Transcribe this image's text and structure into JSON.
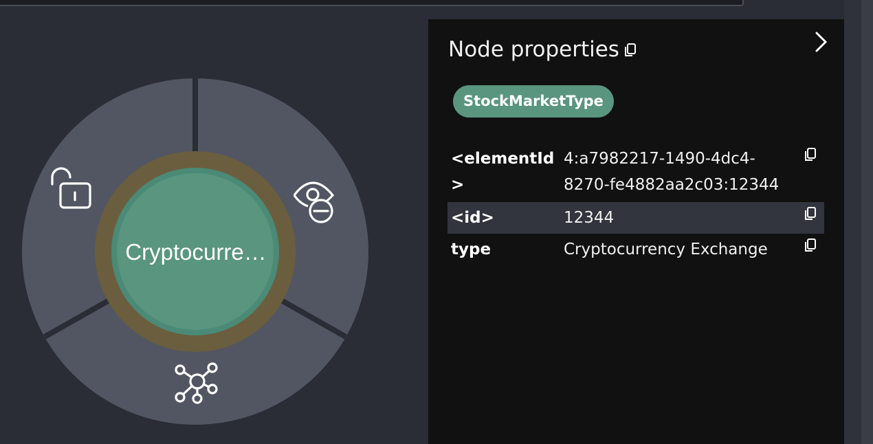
{
  "canvas": {
    "node_label": "Cryptocurre…",
    "ring_colors": {
      "outer": "#525662",
      "node_border": "#6b5e3e",
      "node_fill": "#5a9580"
    },
    "menu": {
      "lock": {
        "icon": "unlock-icon"
      },
      "hide": {
        "icon": "eye-hide-icon"
      },
      "expand": {
        "icon": "graph-expand-icon"
      }
    }
  },
  "panel": {
    "title": "Node properties",
    "title_copy_icon": "copy-icon",
    "collapse_icon": "chevron-right-icon",
    "labels": [
      "StockMarketType"
    ],
    "properties": [
      {
        "key_line1": "<elementId",
        "key_line2": ">",
        "value_line1": "4:a7982217-1490-4dc4-",
        "value_line2": "8270-fe4882aa2c03:12344"
      },
      {
        "key_line1": "<id>",
        "value_line1": "12344"
      },
      {
        "key_line1": "type",
        "value_line1": "Cryptocurrency Exchange"
      }
    ]
  }
}
